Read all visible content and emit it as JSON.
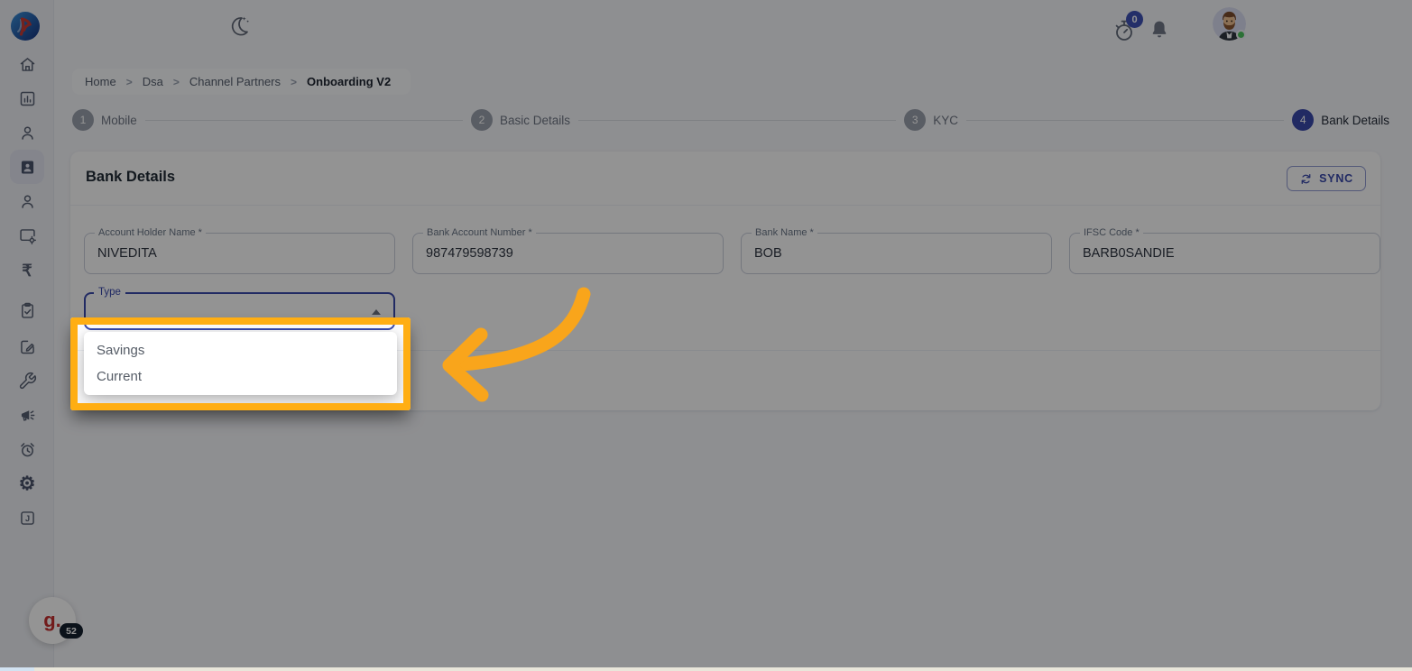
{
  "topbar": {
    "timer_badge": "0",
    "icons": [
      "dark-mode-moon-icon",
      "timer-icon",
      "notifications-bell-icon",
      "user-avatar"
    ]
  },
  "breadcrumb": {
    "items": [
      "Home",
      "Dsa",
      "Channel Partners"
    ],
    "current": "Onboarding V2",
    "separator": ">"
  },
  "stepper": {
    "active_step": 4,
    "steps": [
      {
        "number": "1",
        "label": "Mobile"
      },
      {
        "number": "2",
        "label": "Basic Details"
      },
      {
        "number": "3",
        "label": "KYC"
      },
      {
        "number": "4",
        "label": "Bank Details"
      }
    ]
  },
  "bank_details": {
    "title": "Bank Details",
    "sync_button": "SYNC",
    "fields": [
      {
        "label": "Account Holder Name *",
        "value": "NIVEDITA"
      },
      {
        "label": "Bank Account Number *",
        "value": "987479598739"
      },
      {
        "label": "Bank Name *",
        "value": "BOB"
      },
      {
        "label": "IFSC Code *",
        "value": "BARB0SANDIE"
      }
    ],
    "type_field": {
      "label": "Type",
      "value": ""
    }
  },
  "type_dropdown": {
    "options": [
      "Savings",
      "Current"
    ]
  },
  "sidebar": {
    "active_index": 3,
    "icons": [
      "home",
      "dashboard",
      "person",
      "id-badge",
      "person",
      "window-settings",
      "rupee",
      "clipboard-check",
      "note-edit",
      "wrench",
      "megaphone",
      "alarm-clock",
      "gear",
      "journal-j"
    ],
    "rupee_glyph": "₹",
    "gear_glyph": "⚙",
    "journal_glyph": "J"
  },
  "feedback_widget": {
    "logo": "g.",
    "count": "52"
  },
  "colors": {
    "primary": "#3949AB",
    "step_inactive": "#9AA0AC",
    "highlight_border": "#FFAE13",
    "arrow": "#F9A51B",
    "notification_badge": "#3F51B5",
    "online_green": "#4CC35E",
    "overlay": "rgba(0,0,0,0.42)"
  }
}
